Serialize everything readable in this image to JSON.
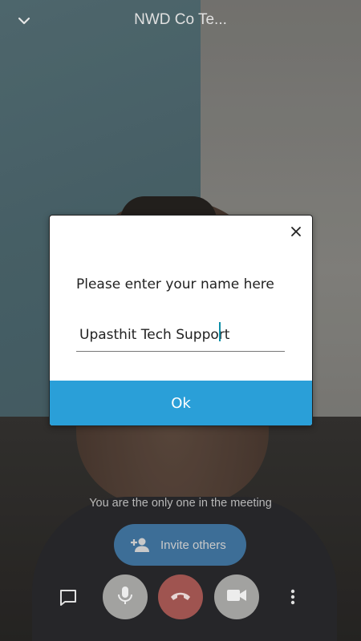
{
  "header": {
    "title": "NWD Co Te..."
  },
  "dialog": {
    "prompt": "Please enter your name here",
    "name_value": "Upasthit Tech Support",
    "ok_label": "Ok"
  },
  "meeting": {
    "only_one_text": "You are the only one in the meeting",
    "invite_label": "Invite others"
  },
  "icons": {
    "back": "chevron-down-icon",
    "close": "close-icon",
    "invite": "person-add-icon",
    "chat": "chat-icon",
    "mic": "microphone-icon",
    "hangup": "hangup-icon",
    "camera": "videocam-icon",
    "more": "more-vertical-icon"
  },
  "colors": {
    "ok_button": "#2a9fd8",
    "invite_button": "#3d6e97",
    "hangup_button": "#9f5450",
    "control_button": "#a2a2a0"
  }
}
